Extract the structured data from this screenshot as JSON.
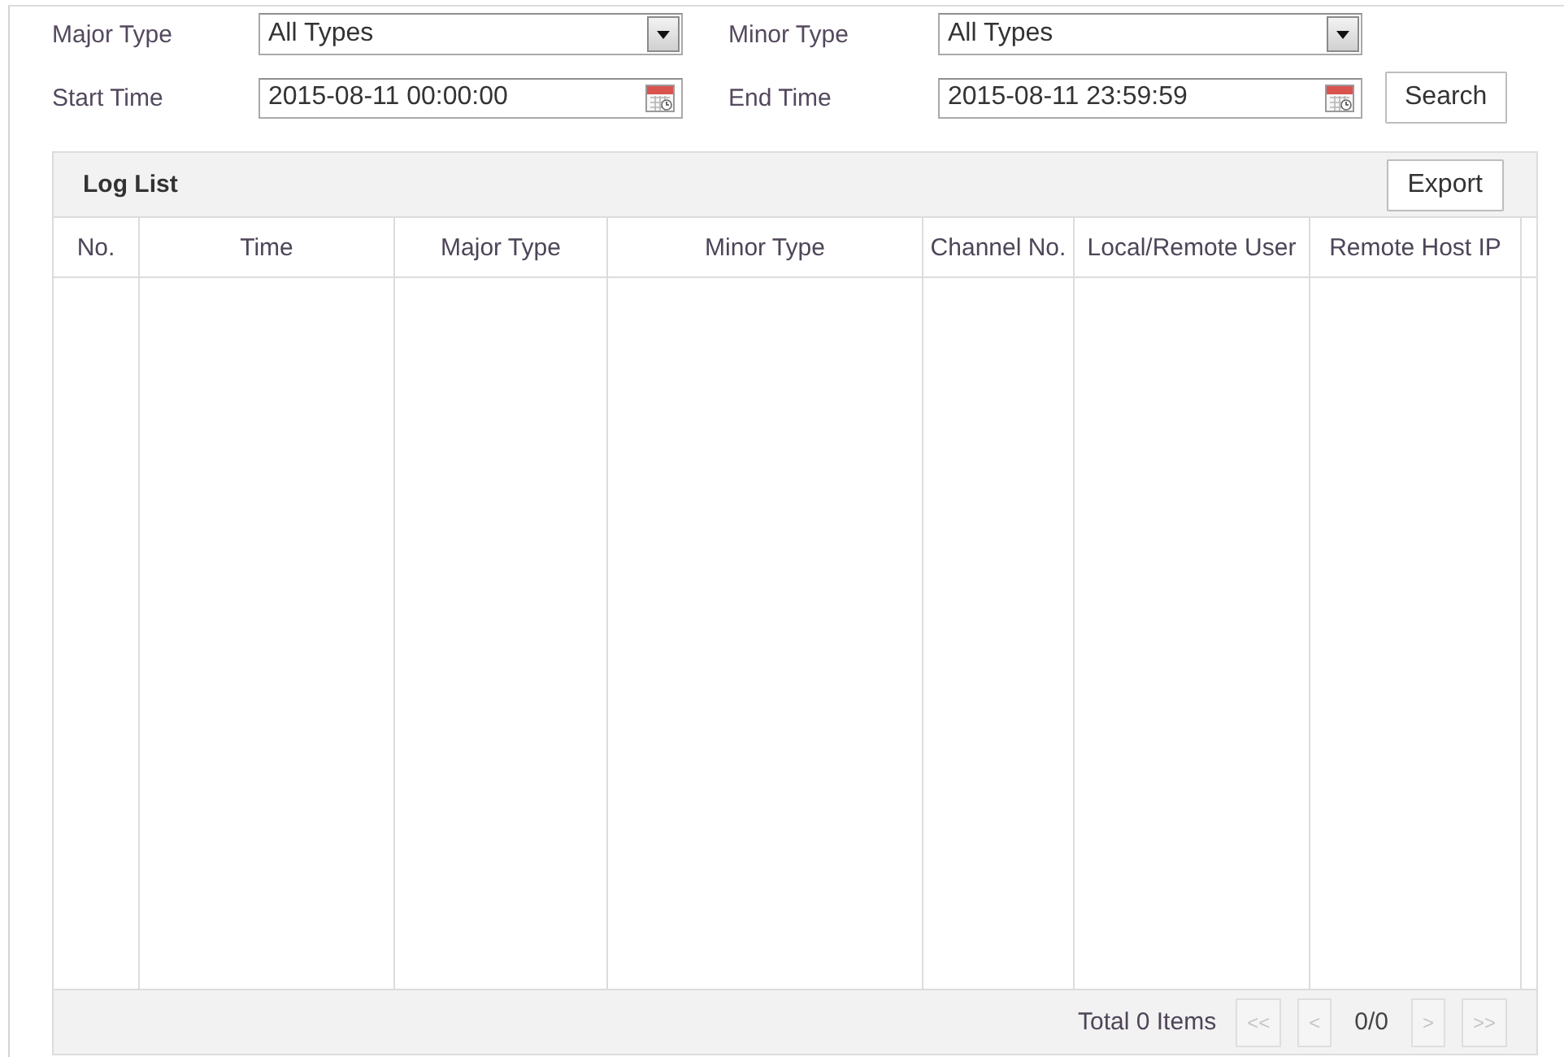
{
  "filters": [
    [
      {
        "kind": "select",
        "label": "Major Type",
        "value": "All Types"
      },
      {
        "kind": "select",
        "label": "Minor Type",
        "value": "All Types"
      }
    ],
    [
      {
        "kind": "datetime",
        "label": "Start Time",
        "value": "2015-08-11 00:00:00"
      },
      {
        "kind": "datetime",
        "label": "End Time",
        "value": "2015-08-11 23:59:59"
      }
    ]
  ],
  "search_button": "Search",
  "log_list": {
    "title": "Log List",
    "export_button": "Export",
    "table": {
      "columns": [
        "No.",
        "Time",
        "Major Type",
        "Minor Type",
        "Channel No.",
        "Local/Remote User",
        "Remote Host IP"
      ]
    },
    "footer": {
      "total": "Total 0 Items",
      "pager": [
        {
          "kind": "button",
          "label": "<<",
          "disabled": true
        },
        {
          "kind": "button",
          "label": "<",
          "disabled": true
        },
        {
          "kind": "page",
          "label": "0/0"
        },
        {
          "kind": "button",
          "label": ">",
          "disabled": true
        },
        {
          "kind": "button",
          "label": ">>",
          "disabled": true
        }
      ]
    }
  }
}
